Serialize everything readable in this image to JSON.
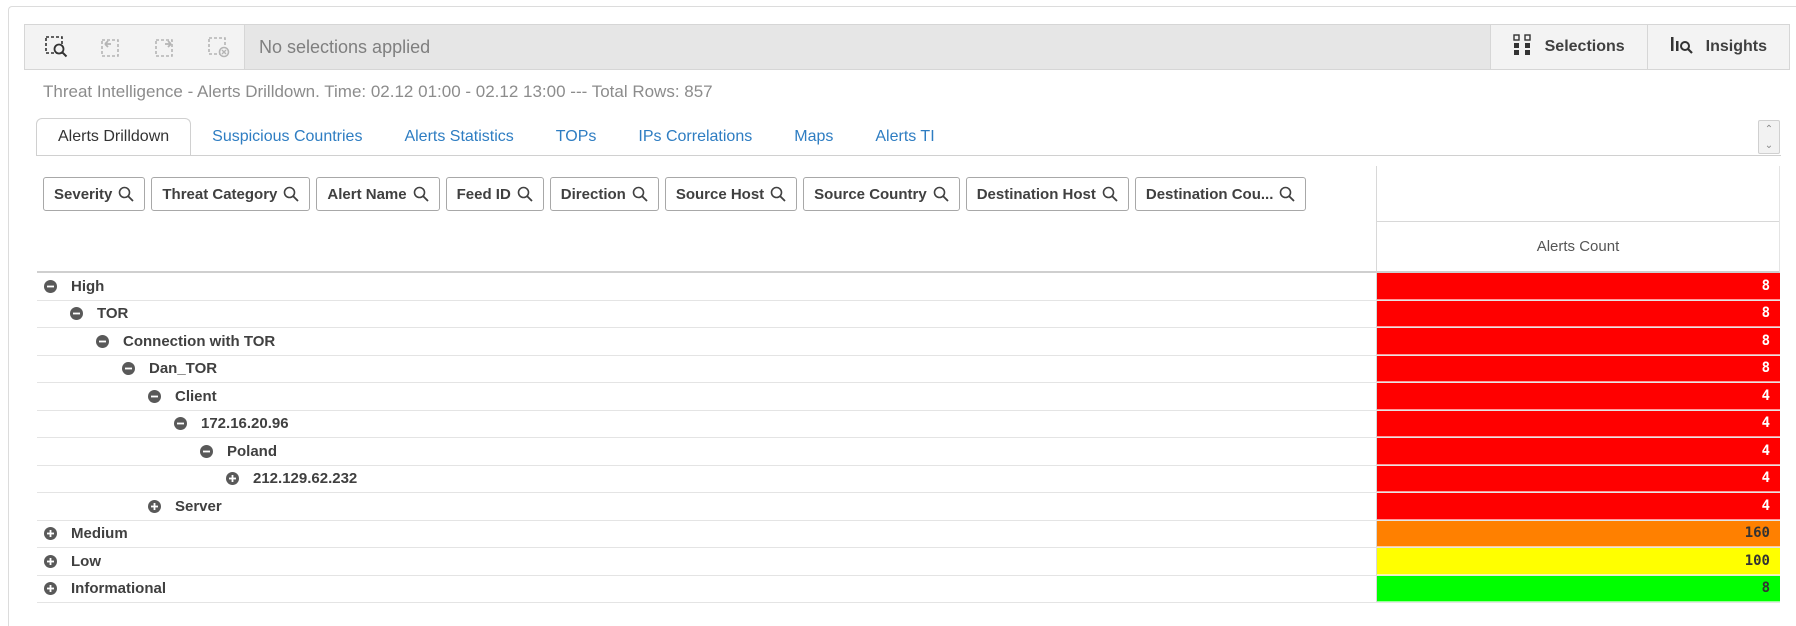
{
  "toolbar": {
    "selection_status": "No selections applied",
    "selections_label": "Selections",
    "insights_label": "Insights",
    "icons": [
      "smart-search-icon",
      "step-back-icon",
      "step-forward-icon",
      "clear-selections-icon",
      "selections-grid-icon",
      "insights-icon"
    ]
  },
  "subtitle": "Threat Intelligence - Alerts Drilldown. Time: 02.12 01:00 - 02.12 13:00 --- Total Rows: 857",
  "tabs": [
    {
      "label": "Alerts Drilldown",
      "active": true
    },
    {
      "label": "Suspicious Countries",
      "active": false
    },
    {
      "label": "Alerts Statistics",
      "active": false
    },
    {
      "label": "TOPs",
      "active": false
    },
    {
      "label": "IPs Correlations",
      "active": false
    },
    {
      "label": "Maps",
      "active": false
    },
    {
      "label": "Alerts TI",
      "active": false
    }
  ],
  "table": {
    "dimensions": [
      "Severity",
      "Threat Category",
      "Alert Name",
      "Feed ID",
      "Direction",
      "Source Host",
      "Source Country",
      "Destination Host",
      "Destination Cou..."
    ],
    "measure_label": "Alerts Count",
    "rows": [
      {
        "label": "High",
        "level": 0,
        "expanded": true,
        "value": "8",
        "color": "#ff0000",
        "text_color": "#ffffff"
      },
      {
        "label": "TOR",
        "level": 1,
        "expanded": true,
        "value": "8",
        "color": "#ff0000",
        "text_color": "#ffffff"
      },
      {
        "label": "Connection with TOR",
        "level": 2,
        "expanded": true,
        "value": "8",
        "color": "#ff0000",
        "text_color": "#ffffff"
      },
      {
        "label": "Dan_TOR",
        "level": 3,
        "expanded": true,
        "value": "8",
        "color": "#ff0000",
        "text_color": "#ffffff"
      },
      {
        "label": "Client",
        "level": 4,
        "expanded": true,
        "value": "4",
        "color": "#ff0000",
        "text_color": "#ffffff"
      },
      {
        "label": "172.16.20.96",
        "level": 5,
        "expanded": true,
        "value": "4",
        "color": "#ff0000",
        "text_color": "#ffffff"
      },
      {
        "label": "Poland",
        "level": 6,
        "expanded": true,
        "value": "4",
        "color": "#ff0000",
        "text_color": "#ffffff"
      },
      {
        "label": "212.129.62.232",
        "level": 7,
        "expanded": false,
        "value": "4",
        "color": "#ff0000",
        "text_color": "#ffffff"
      },
      {
        "label": "Server",
        "level": 4,
        "expanded": false,
        "value": "4",
        "color": "#ff0000",
        "text_color": "#ffffff"
      },
      {
        "label": "Medium",
        "level": 0,
        "expanded": false,
        "value": "160",
        "color": "#ff8000",
        "text_color": "#333333"
      },
      {
        "label": "Low",
        "level": 0,
        "expanded": false,
        "value": "100",
        "color": "#ffff00",
        "text_color": "#333333"
      },
      {
        "label": "Informational",
        "level": 0,
        "expanded": false,
        "value": "8",
        "color": "#00ff00",
        "text_color": "#333333"
      }
    ]
  }
}
